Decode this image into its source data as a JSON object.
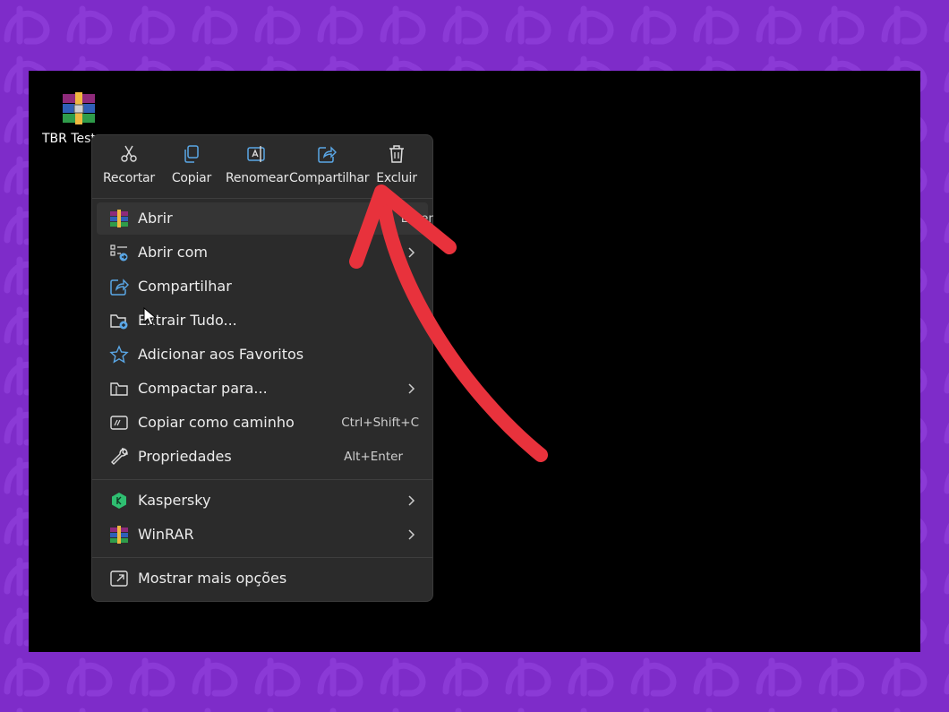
{
  "desktop": {
    "icon_label": "TBR Teste",
    "icon_name": "winrar-archive-icon"
  },
  "quick_actions": [
    {
      "label": "Recortar",
      "icon": "scissors-icon"
    },
    {
      "label": "Copiar",
      "icon": "copy-icon"
    },
    {
      "label": "Renomear",
      "icon": "rename-icon"
    },
    {
      "label": "Compartilhar",
      "icon": "share-icon"
    },
    {
      "label": "Excluir",
      "icon": "trash-icon"
    }
  ],
  "menu_items": [
    {
      "label": "Abrir",
      "shortcut": "Enter",
      "icon": "winrar-icon"
    },
    {
      "label": "Abrir com",
      "shortcut": "",
      "icon": "open-with-icon",
      "submenu": true
    },
    {
      "label": "Compartilhar",
      "shortcut": "",
      "icon": "share-icon"
    },
    {
      "label": "Extrair Tudo...",
      "shortcut": "",
      "icon": "extract-folder-icon"
    },
    {
      "label": "Adicionar aos Favoritos",
      "shortcut": "",
      "icon": "star-icon"
    },
    {
      "label": "Compactar para...",
      "shortcut": "",
      "icon": "compress-icon",
      "submenu": true
    },
    {
      "label": "Copiar como caminho",
      "shortcut": "Ctrl+Shift+C",
      "icon": "copy-path-icon"
    },
    {
      "label": "Propriedades",
      "shortcut": "Alt+Enter",
      "icon": "wrench-icon"
    },
    {
      "label": "Kaspersky",
      "shortcut": "",
      "icon": "kaspersky-icon",
      "submenu": true
    },
    {
      "label": "WinRAR",
      "shortcut": "",
      "icon": "winrar-icon",
      "submenu": true
    },
    {
      "label": "Mostrar mais opções",
      "shortcut": "",
      "icon": "more-options-icon"
    }
  ],
  "colors": {
    "frame": "#7e2cc9",
    "menu_bg": "#2b2b2b",
    "accent_arrow": "#e8323c",
    "icon_blue": "#5aa7e6"
  }
}
